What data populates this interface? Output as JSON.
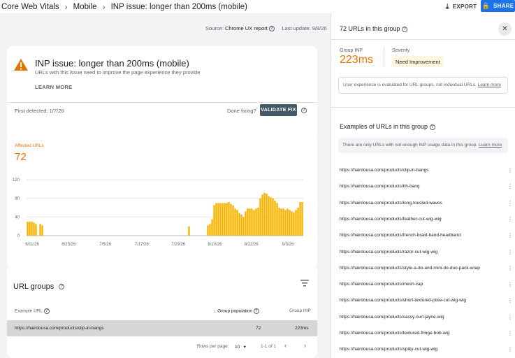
{
  "breadcrumb": [
    "Core Web Vitals",
    "Mobile",
    "INP issue: longer than 200ms (mobile)"
  ],
  "header": {
    "export_label": "EXPORT",
    "share_label": "SHARE"
  },
  "source": {
    "prefix": "Source:",
    "name": "Chrome UX report",
    "last_update_label": "Last update:",
    "last_update": "9/8/26"
  },
  "issue": {
    "title": "INP issue: longer than 200ms (mobile)",
    "subtitle": "URLs with this issue need to improve the page experience they provide",
    "learn_more": "LEARN MORE",
    "first_detected": "First detected: 1/7/26",
    "done_fixing": "Done fixing?",
    "validate_label": "VALIDATE FIX"
  },
  "affected": {
    "label": "Affected URLs",
    "value": "72"
  },
  "chart_data": {
    "type": "bar",
    "ylim": [
      0,
      120
    ],
    "yticks": [
      "120",
      "80",
      "40",
      "0"
    ],
    "xticks": [
      "6/11/26",
      "6/23/26",
      "7/5/26",
      "7/17/26",
      "7/29/26",
      "8/10/26",
      "8/22/26",
      "9/3/26"
    ],
    "values": [
      30,
      30,
      30,
      28,
      25,
      0,
      25,
      22,
      0,
      0,
      0,
      0,
      0,
      0,
      0,
      0,
      0,
      0,
      0,
      0,
      0,
      0,
      0,
      0,
      0,
      0,
      0,
      0,
      0,
      0,
      0,
      0,
      0,
      0,
      0,
      0,
      0,
      0,
      0,
      0,
      0,
      0,
      0,
      0,
      0,
      0,
      0,
      0,
      0,
      0,
      0,
      0,
      0,
      0,
      0,
      0,
      0,
      0,
      0,
      0,
      0,
      0,
      0,
      0,
      0,
      0,
      0,
      0,
      0,
      0,
      0,
      0,
      0,
      0,
      0,
      0,
      0,
      20,
      0,
      0,
      0,
      0,
      0,
      0,
      0,
      0,
      22,
      25,
      35,
      65,
      70,
      70,
      70,
      70,
      70,
      70,
      72,
      68,
      65,
      58,
      55,
      48,
      45,
      40,
      52,
      58,
      58,
      58,
      55,
      58,
      60,
      80,
      88,
      92,
      90,
      85,
      82,
      80,
      75,
      70,
      60,
      58,
      58,
      55,
      58,
      55,
      52,
      50,
      55,
      60,
      72,
      72
    ]
  },
  "url_groups": {
    "title": "URL groups",
    "col_url": "Example URL",
    "col_pop": "Group population",
    "col_inp": "Group INP",
    "row": {
      "url": "https://hairdousa.com/products/clip-in-bangs",
      "population": "72",
      "inp": "223ms"
    },
    "rows_per_page_label": "Rows per page:",
    "rows_per_page": "10",
    "range": "1-1 of 1"
  },
  "panel": {
    "title": "72 URLs in this group",
    "group_inp_label": "Group INP",
    "group_inp": "223ms",
    "severity_label": "Severity",
    "severity": "Need Improvement",
    "note": "User experience is evaluated for URL groups, not individual URLs.",
    "note_link": "Learn more",
    "examples_title": "Examples of URLs in this group",
    "examples_note": "There are only URLs with not enough INP usage data in this group.",
    "examples_link": "Learn more",
    "urls": [
      "https://hairdousa.com/products/clip-in-bangs",
      "https://hairdousa.com/products/hh-bang",
      "https://hairdousa.com/products/long-tousled-waves",
      "https://hairdousa.com/products/feather-cut-wig-wig",
      "https://hairdousa.com/products/french-braid-band-headband",
      "https://hairdousa.com/products/razor-cut-wig-wig",
      "https://hairdousa.com/products/style-a-do-and-mini-do-duo-pack-wrap",
      "https://hairdousa.com/products/mesh-cap",
      "https://hairdousa.com/products/short-textured-pixie-cut-wig-wig",
      "https://hairdousa.com/products/sassy-curl-jayne-wig",
      "https://hairdousa.com/products/textured-fringe-bob-wig",
      "https://hairdousa.com/products/spiky-cut-wig-wig"
    ]
  },
  "colors": {
    "accent": "#e37400",
    "bar": "#f4b400",
    "primary": "#1a73e8",
    "validate": "#455a64"
  }
}
